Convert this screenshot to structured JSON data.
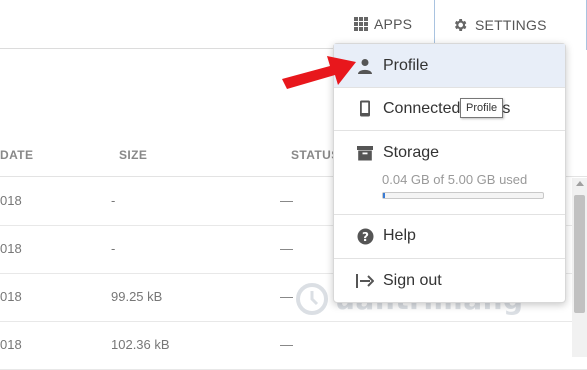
{
  "header": {
    "apps_label": "APPS",
    "settings_label": "SETTINGS"
  },
  "table": {
    "columns": [
      "DATE",
      "SIZE",
      "STATUS"
    ],
    "rows": [
      {
        "date": "018",
        "size": "-",
        "status": "—"
      },
      {
        "date": "018",
        "size": "-",
        "status": "—"
      },
      {
        "date": "018",
        "size": "99.25 kB",
        "status": "—"
      },
      {
        "date": "018",
        "size": "102.36 kB",
        "status": "—"
      }
    ]
  },
  "settings_menu": {
    "profile_label": "Profile",
    "connected_label": "Connected",
    "connected_suffix": "s",
    "storage_label": "Storage",
    "storage_usage": "0.04 GB of 5.00 GB used",
    "storage_fraction": 0.008,
    "help_label": "Help",
    "signout_label": "Sign out"
  },
  "tooltip": {
    "text": "Profile"
  },
  "watermark": {
    "text": "uantrimang"
  },
  "colors": {
    "accent": "#3a7bd5",
    "annotation_arrow": "#e8171c",
    "active_item_bg": "#e8eef8"
  },
  "icons": {
    "apps": "grid-icon",
    "settings": "gear-icon",
    "profile": "person-icon",
    "connected": "phone-icon",
    "storage": "archive-box-icon",
    "help": "question-circle-icon",
    "signout": "sign-out-arrow-icon"
  }
}
